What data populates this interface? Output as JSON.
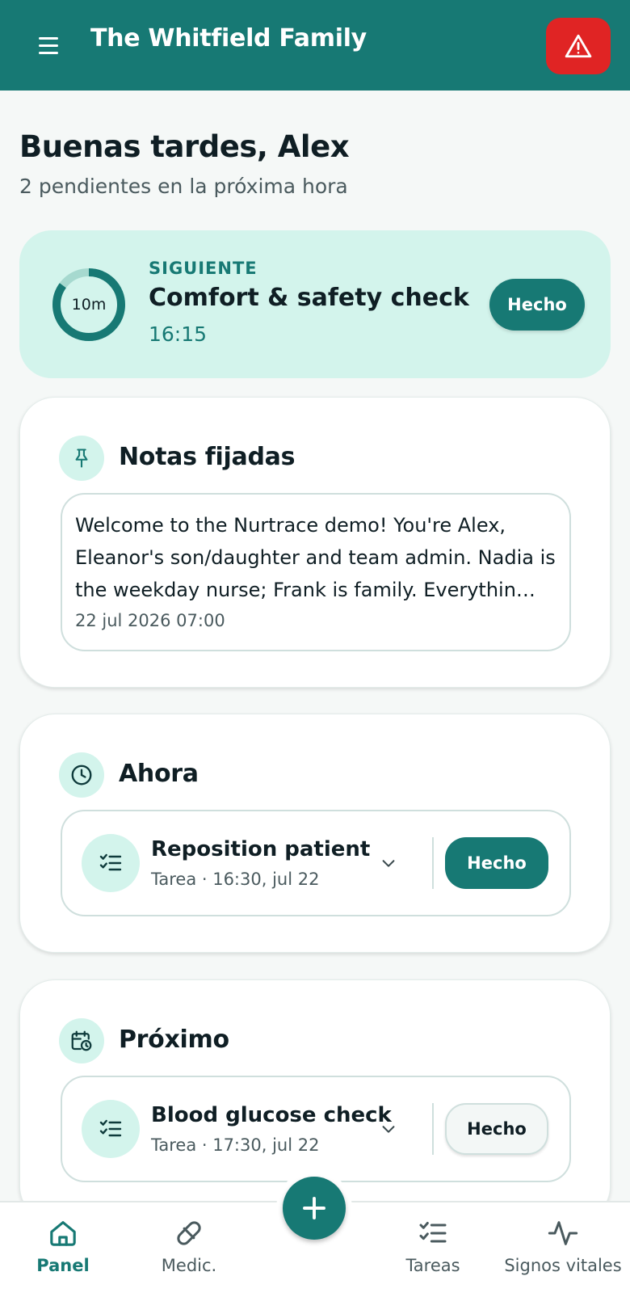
{
  "header": {
    "title": "The Whitfield Family",
    "menu_icon": "hamburger-menu-icon",
    "alert_icon": "warning-triangle-icon",
    "alert_color": "#e02424",
    "brand_color": "#177974"
  },
  "greeting": {
    "title": "Buenas tardes, Alex",
    "subtitle": "2 pendientes en la próxima hora"
  },
  "next_card": {
    "kicker": "SIGUIENTE",
    "title": "Comfort & safety check",
    "time": "16:15",
    "countdown_label": "10m",
    "countdown_progress": 0.85,
    "done_label": "Hecho"
  },
  "pinned": {
    "title": "Notas fijadas",
    "icon": "pin-icon",
    "note_text": "Welcome to the Nurtrace demo! You're Alex, Eleanor's son/daughter and team admin. Nadia is the weekday nurse; Frank is family. Everythin…",
    "note_date": "22 jul 2026 07:00"
  },
  "now": {
    "title": "Ahora",
    "icon": "clock-icon",
    "task": {
      "name": "Reposition patient",
      "meta": "Tarea · 16:30, jul 22",
      "done_label": "Hecho"
    }
  },
  "upcoming": {
    "title": "Próximo",
    "icon": "calendar-clock-icon",
    "task": {
      "name": "Blood glucose check",
      "meta": "Tarea · 17:30, jul 22",
      "done_label": "Hecho"
    }
  },
  "nav": {
    "panel": "Panel",
    "meds": "Medic.",
    "tasks": "Tareas",
    "vitals": "Signos vitales"
  }
}
